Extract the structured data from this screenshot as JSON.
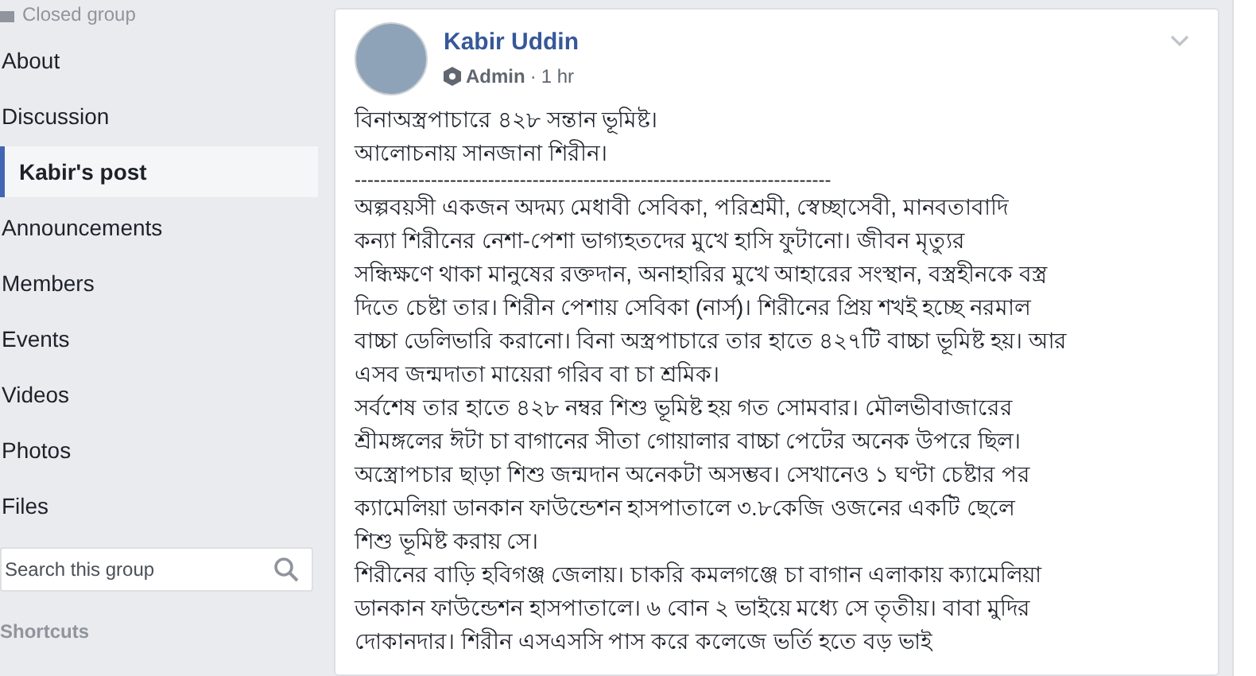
{
  "sidebar": {
    "group_type": "Closed group",
    "items": [
      {
        "label": "About",
        "selected": false
      },
      {
        "label": "Discussion",
        "selected": false
      },
      {
        "label": "Kabir's post",
        "selected": true
      },
      {
        "label": "Announcements",
        "selected": false
      },
      {
        "label": "Members",
        "selected": false
      },
      {
        "label": "Events",
        "selected": false
      },
      {
        "label": "Videos",
        "selected": false
      },
      {
        "label": "Photos",
        "selected": false
      },
      {
        "label": "Files",
        "selected": false
      }
    ],
    "search": {
      "placeholder": "Search this group"
    },
    "section_heading": "Shortcuts"
  },
  "post": {
    "author": "Kabir Uddin",
    "role": "Admin",
    "meta_separator": "·",
    "time": "1 hr",
    "title_lines": [
      "বিনাঅস্ত্রপাচারে ৪২৮ সন্তান ভূমিষ্ট।",
      "আলোচনায় সানজানা শিরীন।"
    ],
    "separator": "---------------------------------------------------------------------------",
    "paragraphs": [
      {
        "lines": [
          "অল্পবয়সী একজন অদম্য মেধাবী সেবিকা, পরিশ্রমী, স্বেচ্ছাসেবী, মানবতাবাদি",
          "কন্যা শিরীনের নেশা-পেশা ভাগ্যহতদের মুখে হাসি ফুটানো। জীবন মৃত্যুর",
          "সন্ধিক্ষণে থাকা মানুষের রক্তদান, অনাহারির মুখে আহারের সংস্থান, বস্ত্রহীনকে বস্ত্র",
          "দিতে চেষ্টা তার। শিরীন পেশায় সেবিকা (নার্স)। শিরীনের প্রিয় শখই হচ্ছে নরমাল",
          "বাচ্চা ডেলিভারি করানো। বিনা অস্ত্রপাচারে তার হাতে ৪২৭টি বাচ্চা ভূমিষ্ট হয়। আর",
          "এসব জন্মদাতা মায়েরা গরিব বা চা শ্রমিক।"
        ]
      },
      {
        "lines": [
          "সর্বশেষ তার হাতে ৪২৮ নম্বর শিশু ভূমিষ্ট হয় গত সোমবার। মৌলভীবাজারের",
          "শ্রীমঙ্গলের ঈটা চা বাগানের সীতা গোয়ালার বাচ্চা পেটের অনেক উপরে ছিল।",
          "অস্ত্রোপচার ছাড়া শিশু জন্মদান অনেকটা অসম্ভব। সেখানেও ১ ঘণ্টা চেষ্টার পর",
          "ক্যামেলিয়া ডানকান ফাউন্ডেশন হাসপাতালে ৩.৮কেজি ওজনের একটি ছেলে",
          "শিশু ভূমিষ্ট করায় সে।"
        ]
      },
      {
        "lines": [
          "শিরীনের বাড়ি হবিগঞ্জ জেলায়। চাকরি কমলগঞ্জে চা বাগান এলাকায় ক্যামেলিয়া",
          "ডানকান ফাউন্ডেশন হাসপাতালে। ৬ বোন ২ ভাইয়ে মধ্যে সে তৃতীয়। বাবা মুদির",
          "দোকানদার। শিরীন এসএসসি পাস করে কলেজে ভর্তি হতে বড় ভাই"
        ]
      }
    ]
  }
}
